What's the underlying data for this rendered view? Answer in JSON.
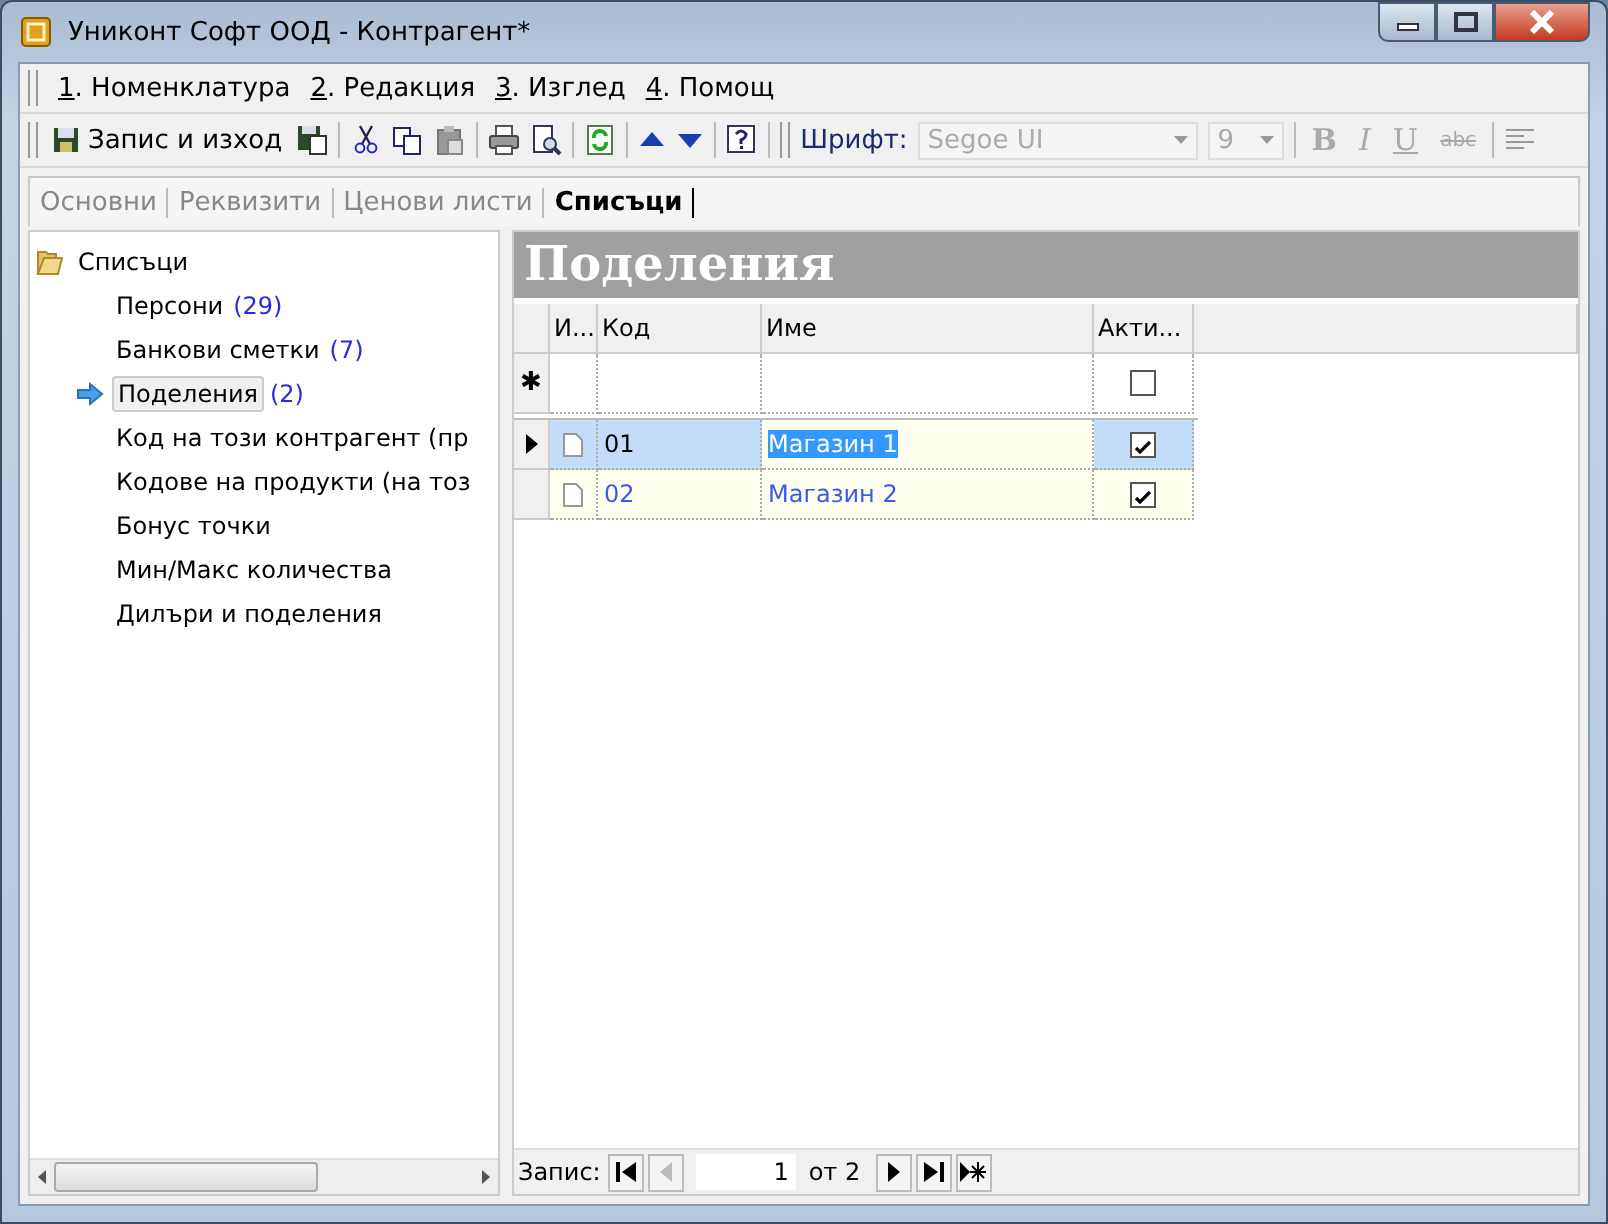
{
  "window": {
    "title": "Униконт Софт ООД - Контрагент*"
  },
  "menu": [
    "1. Номенклатура",
    "2. Редакция",
    "3. Изглед",
    "4. Помощ"
  ],
  "toolbar": {
    "save_label": "Запис и изход",
    "font_label": "Шрифт:",
    "font": {
      "value": "Segoe UI",
      "disabled": true
    },
    "size": {
      "value": "9",
      "disabled": true
    },
    "format_buttons": [
      {
        "label": "B",
        "kind": "bold",
        "disabled": true
      },
      {
        "label": "I",
        "kind": "italic",
        "disabled": true
      },
      {
        "label": "U",
        "kind": "underline",
        "disabled": true
      },
      {
        "label": "abc",
        "kind": "strike",
        "disabled": true
      }
    ]
  },
  "tabs": [
    {
      "label": "Основни",
      "selected": false
    },
    {
      "label": "Реквизити",
      "selected": false
    },
    {
      "label": "Ценови листи",
      "selected": false
    },
    {
      "label": "Списъци",
      "selected": true
    }
  ],
  "tree": {
    "label": "Списъци",
    "expanded": true,
    "children": [
      {
        "label": "Персони",
        "count": "(29)",
        "selected": false
      },
      {
        "label": "Банкови сметки",
        "count": "(7)",
        "selected": false
      },
      {
        "label": "Поделения",
        "count": "(2)",
        "selected": true
      },
      {
        "label": "Код на този контрагент (пр",
        "selected": false
      },
      {
        "label": "Кодове на продукти (на тоз",
        "selected": false
      },
      {
        "label": "Бонус точки",
        "selected": false
      },
      {
        "label": "Мин/Макс количества",
        "selected": false
      },
      {
        "label": "Дилъри и поделения",
        "selected": false
      }
    ]
  },
  "grid": {
    "title": "Поделения",
    "columns": [
      "И...",
      "Код",
      "Име",
      "Акти..."
    ],
    "new_row": {
      "marker": "✱",
      "active": false
    },
    "rows": [
      {
        "code": "01",
        "name": "Магазин 1",
        "active": true,
        "selected": true
      },
      {
        "code": "02",
        "name": "Магазин 2",
        "active": true,
        "selected": false
      }
    ]
  },
  "navigator": {
    "label": "Запис:",
    "current": "1",
    "total": "от 2"
  }
}
